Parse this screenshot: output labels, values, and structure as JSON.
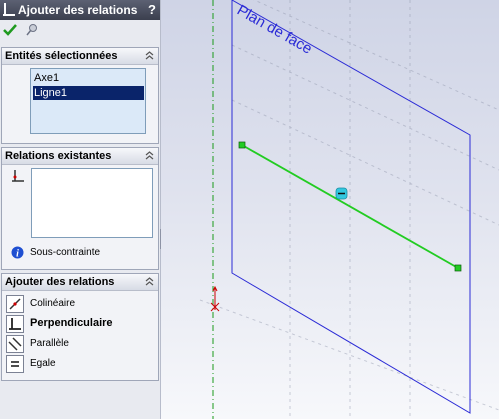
{
  "title_bar": {
    "title": "Ajouter des relations",
    "help": "?"
  },
  "toolbar": {
    "ok_icon": "check-icon",
    "pin_icon": "pushpin-icon"
  },
  "selected_entities": {
    "header": "Entités sélectionnées",
    "items": [
      {
        "label": "Axe1",
        "selected": false
      },
      {
        "label": "Ligne1",
        "selected": true
      }
    ]
  },
  "existing_relations": {
    "header": "Relations existantes",
    "items": [],
    "status": "Sous-contrainte"
  },
  "add_relations": {
    "header": "Ajouter des relations",
    "options": [
      {
        "label": "Colinéaire",
        "icon": "collinear-icon",
        "bold": false
      },
      {
        "label": "Perpendiculaire",
        "icon": "perpendicular-icon",
        "bold": true
      },
      {
        "label": "Parallèle",
        "icon": "parallel-icon",
        "bold": false
      },
      {
        "label": "Egale",
        "icon": "equal-icon",
        "bold": false
      }
    ]
  },
  "viewport": {
    "plane_label": "Plan de face",
    "colors": {
      "plane": "#2b2bd6",
      "line": "#22cc22",
      "axis": "#1a9a1a",
      "origin": "#cc0000",
      "midpoint": "#33c8e0"
    }
  }
}
